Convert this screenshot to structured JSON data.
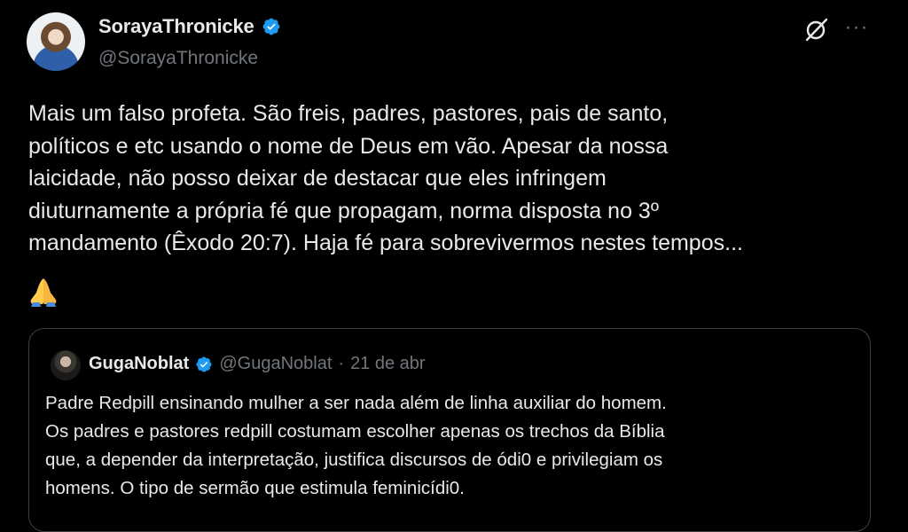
{
  "tweet": {
    "display_name": "SorayaThronicke",
    "handle": "@SorayaThronicke",
    "lines": [
      "Mais um falso profeta. São freis, padres, pastores, pais de santo,",
      "políticos e etc usando o nome de Deus em vão. Apesar da nossa",
      "laicidade, não posso deixar de destacar que eles infringem",
      "diuturnamente a própria fé que propagam, norma disposta no  3º",
      "mandamento (Êxodo 20:7). Haja fé para sobrevivermos nestes tempos..."
    ],
    "emoji": "🙏"
  },
  "quote": {
    "display_name": "GugaNoblat",
    "handle": "@GugaNoblat",
    "separator": "·",
    "date": "21 de abr",
    "lines": [
      "Padre Redpill ensinando mulher a ser nada além de linha auxiliar do homem.",
      "Os padres e pastores redpill costumam escolher apenas os trechos da Bíblia",
      "que, a depender da interpretação, justifica discursos de ódi0 e privilegiam os",
      "homens. O tipo de sermão que estimula feminicídi0."
    ]
  },
  "icons": {
    "verified": "verified-badge-icon",
    "grok": "grok-icon",
    "more": "more-options-icon",
    "more_glyph": "···"
  },
  "colors": {
    "background": "#000000",
    "text": "#e7e9ea",
    "secondary": "#71767b",
    "verified": "#1d9bf0",
    "border": "#3b4045"
  }
}
